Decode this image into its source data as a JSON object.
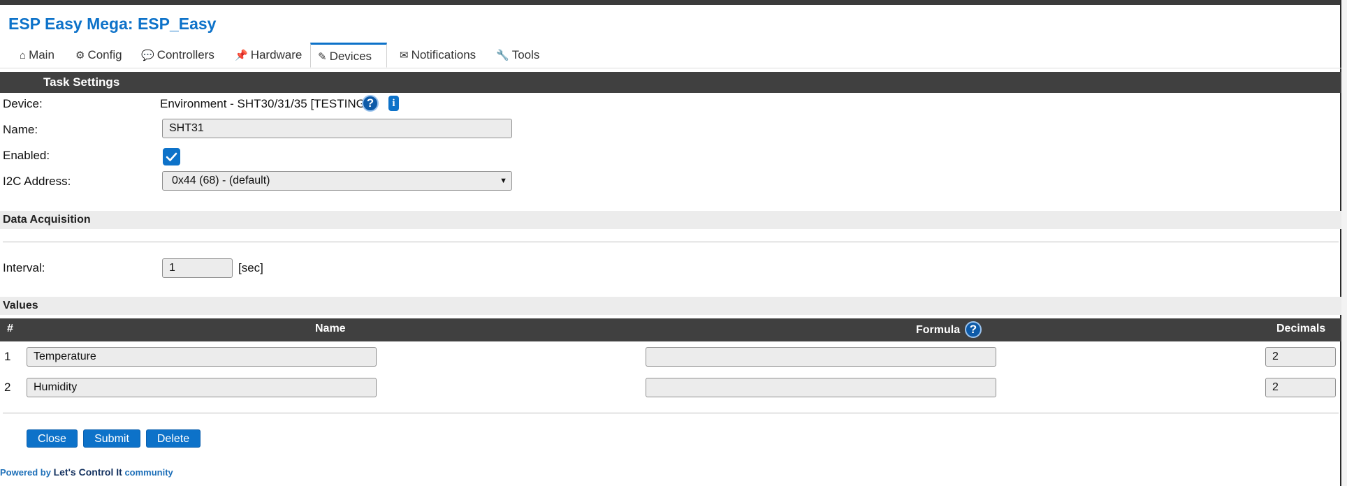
{
  "app": {
    "title": "ESP Easy Mega: ESP_Easy"
  },
  "tabs": [
    {
      "label": "Main",
      "icon": "⌂"
    },
    {
      "label": "Config",
      "icon": "⚙"
    },
    {
      "label": "Controllers",
      "icon": "💬"
    },
    {
      "label": "Hardware",
      "icon": "📌"
    },
    {
      "label": "Devices",
      "icon": "✎",
      "active": true
    },
    {
      "label": "Notifications",
      "icon": "✉"
    },
    {
      "label": "Tools",
      "icon": "🔧"
    }
  ],
  "task_settings": {
    "header": "Task Settings",
    "device_label": "Device:",
    "device_value": "Environment - SHT30/31/35 [TESTING]",
    "name_label": "Name:",
    "name_value": "SHT31",
    "enabled_label": "Enabled:",
    "enabled": true,
    "i2c_label": "I2C Address:",
    "i2c_value": "0x44 (68) - (default)"
  },
  "data_acquisition": {
    "header": "Data Acquisition",
    "interval_label": "Interval:",
    "interval_value": "1",
    "interval_unit": "[sec]"
  },
  "values": {
    "header": "Values",
    "columns": [
      "#",
      "Name",
      "Formula",
      "Decimals"
    ],
    "rows": [
      {
        "num": "1",
        "name": "Temperature",
        "formula": "",
        "decimals": "2"
      },
      {
        "num": "2",
        "name": "Humidity",
        "formula": "",
        "decimals": "2"
      }
    ]
  },
  "buttons": {
    "close": "Close",
    "submit": "Submit",
    "delete": "Delete"
  },
  "footer": {
    "prefix": "Powered by",
    "link": "Let's Control It",
    "suffix": "community"
  },
  "colors": {
    "accent": "#0d72c9",
    "header_dark": "#404040",
    "section_light": "#ececec"
  },
  "help_glyph": "?",
  "info_glyph": "i"
}
